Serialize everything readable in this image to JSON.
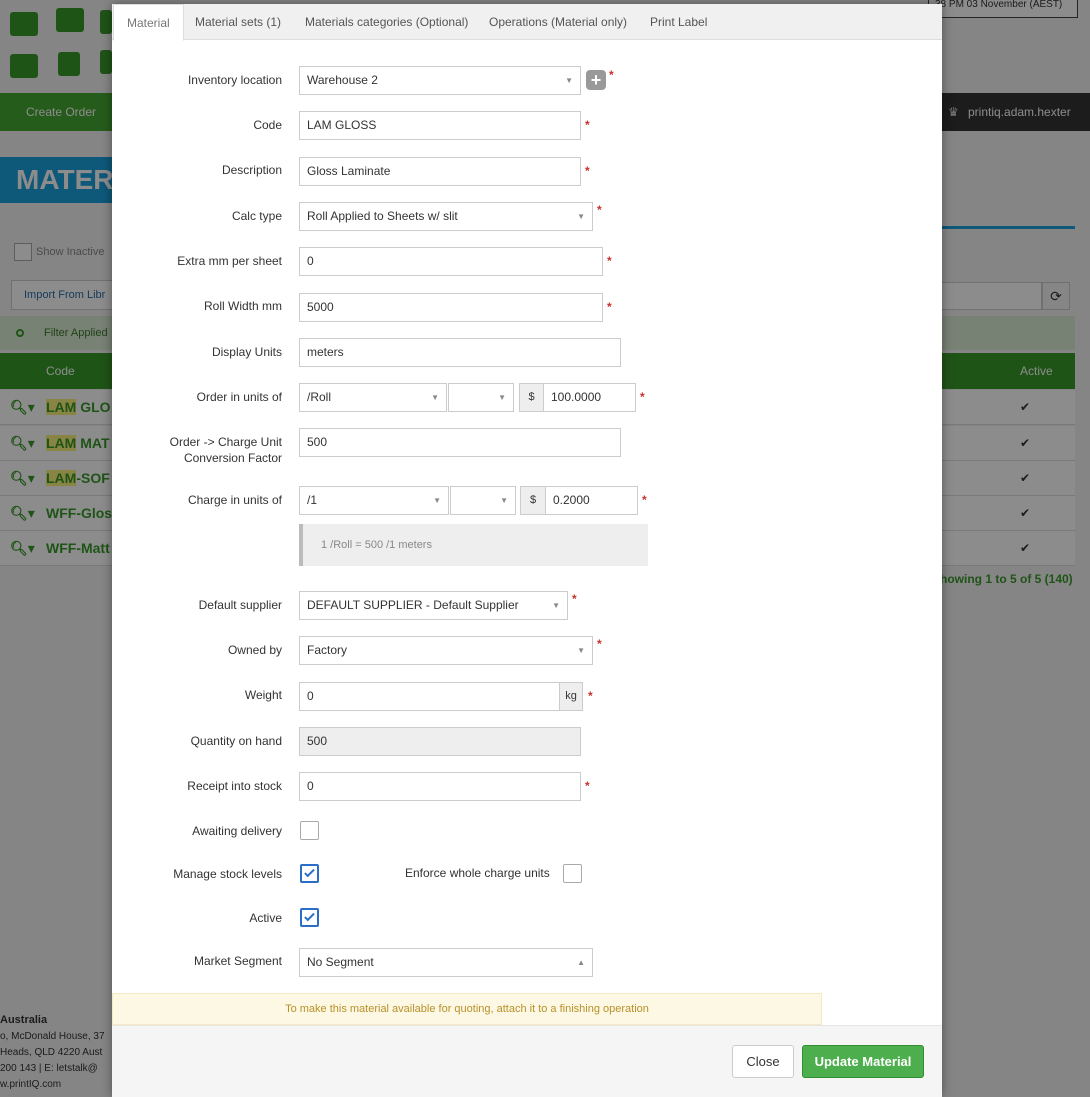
{
  "background": {
    "clock_text": "38 PM  03 November (AEST)",
    "create_order": "Create Order",
    "username": "printiq.adam.hexter",
    "page_title": "MATER",
    "show_inactive": "Show Inactive",
    "import_from_library": "Import From Libr",
    "filter_applied": "Filter Applied",
    "table": {
      "headers": [
        "Code",
        "Active"
      ],
      "rows": [
        {
          "prefix": "LAM",
          "rest": " GLO"
        },
        {
          "prefix": "LAM",
          "rest": " MAT"
        },
        {
          "prefix": "LAM",
          "rest": "-SOF"
        },
        {
          "prefix": "",
          "rest": "WFF-Glos"
        },
        {
          "prefix": "",
          "rest": "WFF-Matt"
        }
      ]
    },
    "showing": "howing 1 to 5 of 5 (140)",
    "footer": {
      "line1": "Australia",
      "line2": "o, McDonald House, 37",
      "line3": "Heads, QLD 4220 Aust",
      "line4": "200 143 | E: letstalk@",
      "line5": "w.printIQ.com"
    }
  },
  "tabs": [
    {
      "label": "Material",
      "active": true
    },
    {
      "label": "Material sets (1)",
      "active": false
    },
    {
      "label": "Materials categories (Optional)",
      "active": false
    },
    {
      "label": "Operations (Material only)",
      "active": false
    },
    {
      "label": "Print Label",
      "active": false
    }
  ],
  "form": {
    "inventory_location": {
      "label": "Inventory location",
      "value": "Warehouse 2"
    },
    "code": {
      "label": "Code",
      "value": "LAM GLOSS"
    },
    "description": {
      "label": "Description",
      "value": "Gloss Laminate"
    },
    "calc_type": {
      "label": "Calc type",
      "value": "Roll Applied to Sheets w/ slit"
    },
    "extra_mm": {
      "label": "Extra mm per sheet",
      "value": "0"
    },
    "roll_width": {
      "label": "Roll Width mm",
      "value": "5000"
    },
    "display_units": {
      "label": "Display Units",
      "value": "meters"
    },
    "order_units": {
      "label": "Order in units of",
      "unit": "/Roll",
      "sub": "",
      "currency": "$",
      "price": "100.0000"
    },
    "conversion": {
      "label": "Order -> Charge Unit Conversion Factor",
      "value": "500"
    },
    "charge_units": {
      "label": "Charge in units of",
      "unit": "/1",
      "sub": "",
      "currency": "$",
      "price": "0.2000"
    },
    "conversion_note": "1 /Roll = 500 /1 meters",
    "default_supplier": {
      "label": "Default supplier",
      "value": "DEFAULT SUPPLIER - Default Supplier"
    },
    "owned_by": {
      "label": "Owned by",
      "value": "Factory"
    },
    "weight": {
      "label": "Weight",
      "value": "0",
      "unit": "kg"
    },
    "quantity_on_hand": {
      "label": "Quantity on hand",
      "value": "500"
    },
    "receipt_into_stock": {
      "label": "Receipt into stock",
      "value": "0"
    },
    "awaiting_delivery": {
      "label": "Awaiting delivery",
      "checked": false
    },
    "manage_stock_levels": {
      "label": "Manage stock levels",
      "checked": true
    },
    "enforce_whole_charge_units": {
      "label": "Enforce whole charge units",
      "checked": false
    },
    "active": {
      "label": "Active",
      "checked": true
    },
    "market_segment": {
      "label": "Market Segment",
      "value": "No Segment"
    }
  },
  "required_marker": "*",
  "info_message": "To make this material available for quoting, attach it to a finishing operation",
  "buttons": {
    "close": "Close",
    "update": "Update Material"
  }
}
